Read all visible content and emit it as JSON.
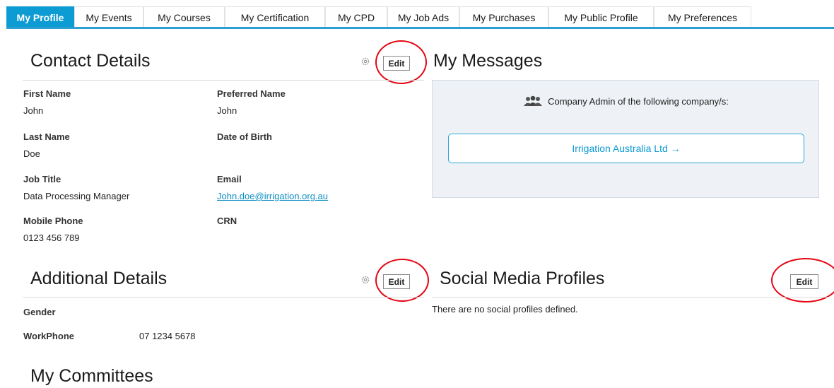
{
  "tabs": [
    {
      "label": "My Profile",
      "active": true
    },
    {
      "label": "My Events",
      "active": false
    },
    {
      "label": "My Courses",
      "active": false
    },
    {
      "label": "My Certification",
      "active": false
    },
    {
      "label": "My CPD",
      "active": false
    },
    {
      "label": "My Job Ads",
      "active": false
    },
    {
      "label": "My Purchases",
      "active": false
    },
    {
      "label": "My Public Profile",
      "active": false
    },
    {
      "label": "My Preferences",
      "active": false
    }
  ],
  "contact": {
    "title": "Contact Details",
    "edit_label": "Edit",
    "fields": {
      "first_name": {
        "label": "First Name",
        "value": "John"
      },
      "preferred_name": {
        "label": "Preferred Name",
        "value": "John"
      },
      "last_name": {
        "label": "Last Name",
        "value": "Doe"
      },
      "dob": {
        "label": "Date of Birth",
        "value": ""
      },
      "job_title": {
        "label": "Job Title",
        "value": "Data Processing Manager"
      },
      "email": {
        "label": "Email",
        "value": "John.doe@irrigation.org.au"
      },
      "mobile": {
        "label": "Mobile Phone",
        "value": "0123 456 789"
      },
      "crn": {
        "label": "CRN",
        "value": ""
      }
    }
  },
  "messages": {
    "title": "My Messages",
    "admin_text": "Company Admin of the following company/s:",
    "company_button": "Irrigation Australia Ltd  →"
  },
  "additional": {
    "title": "Additional Details",
    "edit_label": "Edit",
    "gender_label": "Gender",
    "gender_value": "",
    "workphone_label": "WorkPhone",
    "workphone_value": "07 1234 5678"
  },
  "social": {
    "title": "Social Media Profiles",
    "edit_label": "Edit",
    "empty_text": "There are no social profiles defined."
  },
  "committees": {
    "title": "My Committees"
  },
  "colors": {
    "accent": "#0d9bd3",
    "highlight_ring": "#e30613",
    "panel_bg": "#eef2f6"
  }
}
